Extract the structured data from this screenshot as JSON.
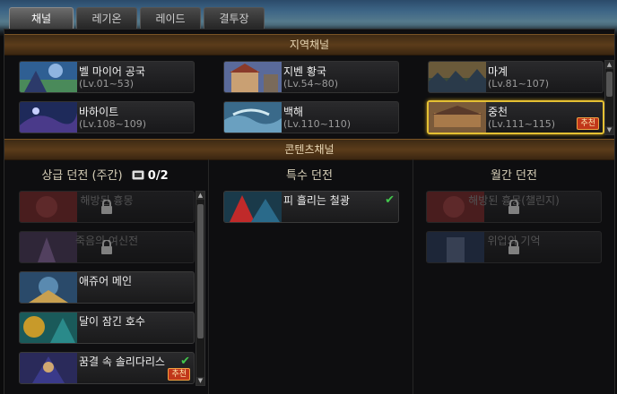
{
  "tabs": [
    {
      "label": "채널",
      "active": true
    },
    {
      "label": "레기온",
      "active": false
    },
    {
      "label": "레이드",
      "active": false
    },
    {
      "label": "결투장",
      "active": false
    }
  ],
  "region_section": {
    "title": "지역채널"
  },
  "regions": [
    {
      "name": "벨 마이어 공국",
      "level": "(Lv.01~53)"
    },
    {
      "name": "지벤 황국",
      "level": "(Lv.54~80)"
    },
    {
      "name": "마계",
      "level": "(Lv.81~107)"
    },
    {
      "name": "바하이트",
      "level": "(Lv.108~109)"
    },
    {
      "name": "백해",
      "level": "(Lv.110~110)"
    },
    {
      "name": "중천",
      "level": "(Lv.111~115)",
      "badge": "추천",
      "selected": true
    }
  ],
  "content_section": {
    "title": "콘텐츠채널"
  },
  "weekly": {
    "title": "상급 던전 (주간)",
    "count": "0/2",
    "items": [
      {
        "name": "해방된 흉몽",
        "locked": true
      },
      {
        "name": "죽음의 여신전",
        "locked": true
      },
      {
        "name": "애쥬어 메인",
        "locked": false
      },
      {
        "name": "달이 잠긴 호수",
        "locked": false
      },
      {
        "name": "꿈결 속 솔리다리스",
        "locked": false,
        "badge": "추천",
        "checked": true
      }
    ]
  },
  "special": {
    "title": "특수 던전",
    "items": [
      {
        "name": "피 흘리는 철광",
        "locked": false,
        "checked": true
      }
    ]
  },
  "monthly": {
    "title": "월간 던전",
    "items": [
      {
        "name": "해방된 흉몽(챌린지)",
        "locked": true
      },
      {
        "name": "위업의 기억",
        "locked": true
      }
    ]
  },
  "colors": {
    "accent": "#e4c033",
    "badge": "#c1371a",
    "check": "#43c84d",
    "section_bar": "#5b3c1a"
  }
}
